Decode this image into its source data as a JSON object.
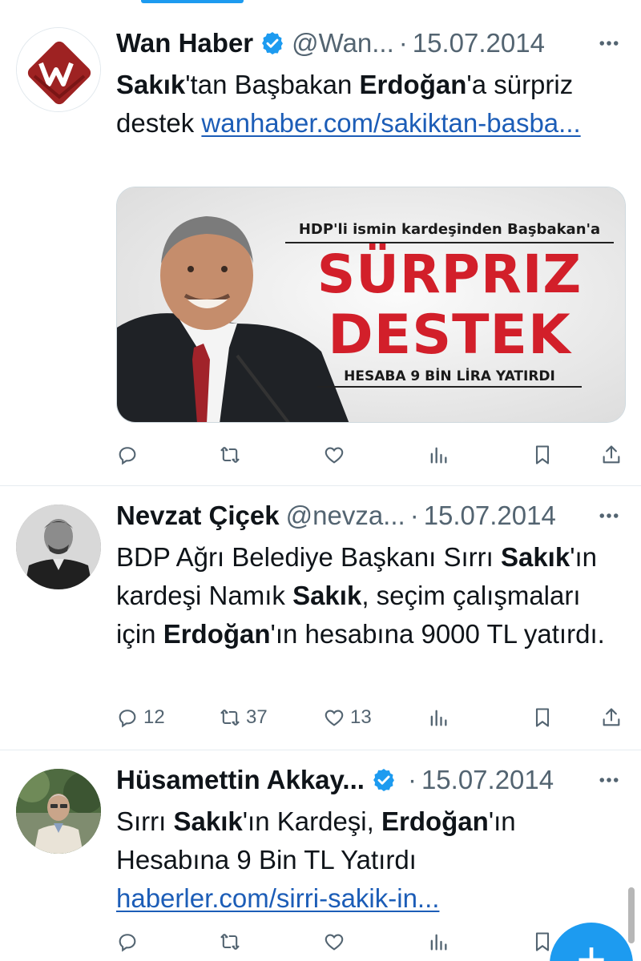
{
  "tweets": [
    {
      "name": "Wan Haber",
      "verified": true,
      "handle": "@Wan...",
      "dot": "·",
      "date": "15.07.2014",
      "text_parts": {
        "b1": "Sakık",
        "t1": "'tan Başbakan ",
        "b2": "Erdoğan",
        "t2": "'a sürpriz destek ",
        "link": "wanhaber.com/sakiktan-basba..."
      },
      "media": {
        "kicker": "HDP'li ismin kardeşinden Başbakan'a",
        "headline1": "SÜRPRIZ",
        "headline2": "DESTEK",
        "subline": "HESABA 9 BİN LİRA YATIRDI"
      },
      "stats": {
        "replies": "",
        "retweets": "",
        "likes": ""
      }
    },
    {
      "name": "Nevzat Çiçek",
      "verified": false,
      "handle": "@nevza...",
      "dot": "·",
      "date": "15.07.2014",
      "text_parts": {
        "t1": "BDP Ağrı Belediye Başkanı Sırrı ",
        "b1": "Sakık",
        "t2": "'ın kardeşi Namık ",
        "b2": "Sakık",
        "t3": ", seçim çalışmaları için ",
        "b3": "Erdoğan",
        "t4": "'ın hesabına 9000 TL yatırdı."
      },
      "stats": {
        "replies": "12",
        "retweets": "37",
        "likes": "13"
      }
    },
    {
      "name": "Hüsamettin Akkay...",
      "verified": true,
      "handle": "",
      "dot": "·",
      "date": "15.07.2014",
      "text_parts": {
        "t1": "Sırrı ",
        "b1": "Sakık",
        "t2": "'ın Kardeşi, ",
        "b2": "Erdoğan",
        "t3": "'ın Hesabına 9 Bin TL Yatırdı ",
        "link": "haberler.com/sirri-sakik-in..."
      },
      "stats": {
        "replies": "",
        "retweets": "",
        "likes": ""
      }
    }
  ],
  "icons": {
    "reply": "reply-icon",
    "retweet": "retweet-icon",
    "like": "heart-icon",
    "views": "views-icon",
    "bookmark": "bookmark-icon",
    "share": "share-icon",
    "more": "more-icon",
    "verified": "verified-badge-icon",
    "compose": "compose-plus-icon"
  },
  "fab": {
    "label": "+"
  },
  "colors": {
    "accent": "#1d9bf0",
    "link": "#1c5db7",
    "muted": "#536471",
    "headline_red": "#d21f2a"
  }
}
